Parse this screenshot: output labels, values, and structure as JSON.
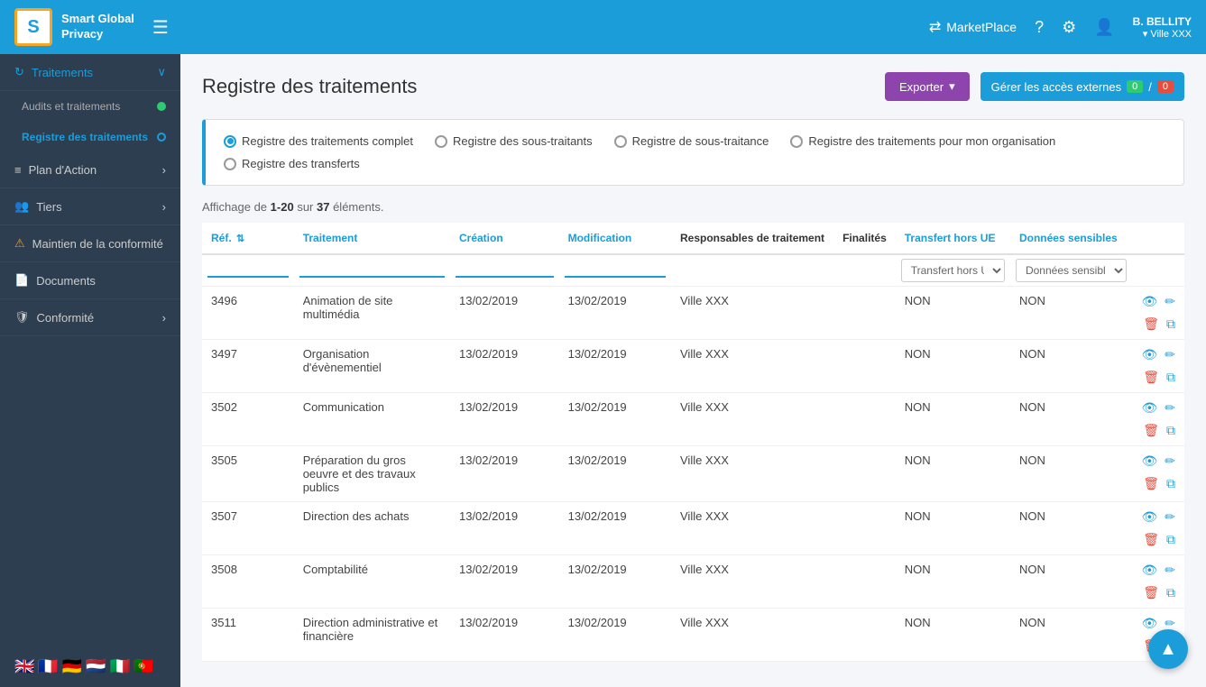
{
  "topnav": {
    "logo_letter": "S",
    "logo_text_line1": "Smart Global",
    "logo_text_line2": "Privacy",
    "menu_icon": "☰",
    "marketplace_label": "MarketPlace",
    "user_name": "B. BELLITY",
    "user_org": "▾ Ville XXX"
  },
  "sidebar": {
    "items": [
      {
        "label": "Traitements",
        "icon": "↻",
        "arrow": "∨",
        "active": true,
        "has_dot": "blue"
      },
      {
        "label": "Audits et traitements",
        "sub": true,
        "has_dot": "green"
      },
      {
        "label": "Registre des traitements",
        "sub": true,
        "has_dot": "outline",
        "active": true
      },
      {
        "label": "Plan d'Action",
        "icon": "≡",
        "arrow": "›"
      },
      {
        "label": "Tiers",
        "icon": "👥",
        "arrow": "›"
      },
      {
        "label": "Maintien de la conformité",
        "icon": "⚠",
        "warn": true
      },
      {
        "label": "Documents",
        "icon": "📄"
      },
      {
        "label": "Conformité",
        "icon": "🛡",
        "arrow": "›"
      }
    ],
    "flags": [
      "🇬🇧",
      "🇫🇷",
      "🇩🇪",
      "🇳🇱",
      "🇮🇹",
      "🇵🇹"
    ]
  },
  "page": {
    "title": "Registre des traitements",
    "export_btn": "Exporter",
    "acces_btn": "Gérer les accès externes",
    "acces_count1": "0",
    "acces_sep": "/",
    "acces_count2": "0"
  },
  "filters": {
    "options": [
      {
        "label": "Registre des traitements complet",
        "selected": true
      },
      {
        "label": "Registre des sous-traitants",
        "selected": false
      },
      {
        "label": "Registre de sous-traitance",
        "selected": false
      },
      {
        "label": "Registre des traitements pour mon organisation",
        "selected": false
      },
      {
        "label": "Registre des transferts",
        "selected": false
      }
    ]
  },
  "table": {
    "count_text": "Affichage de ",
    "count_range": "1-20",
    "count_mid": " sur ",
    "count_total": "37",
    "count_end": " éléments.",
    "columns": [
      {
        "label": "Réf.",
        "color": "blue",
        "sort": true
      },
      {
        "label": "Traitement",
        "color": "blue"
      },
      {
        "label": "Création",
        "color": "blue"
      },
      {
        "label": "Modification",
        "color": "blue"
      },
      {
        "label": "Responsables de traitement",
        "color": "dark"
      },
      {
        "label": "Finalités",
        "color": "dark"
      },
      {
        "label": "Transfert hors UE",
        "color": "blue"
      },
      {
        "label": "Données sensibles",
        "color": "blue"
      },
      {
        "label": "",
        "color": "dark"
      }
    ],
    "filter_placeholders": {
      "transfert": "Transfert hors UE",
      "donnees": "Données sensibles"
    },
    "rows": [
      {
        "ref": "3496",
        "traitement": "Animation de site multimédia",
        "creation": "13/02/2019",
        "modification": "13/02/2019",
        "responsables": "Ville XXX",
        "finalites": "",
        "transfert": "NON",
        "donnees": "NON"
      },
      {
        "ref": "3497",
        "traitement": "Organisation d'évènementiel",
        "creation": "13/02/2019",
        "modification": "13/02/2019",
        "responsables": "Ville XXX",
        "finalites": "",
        "transfert": "NON",
        "donnees": "NON"
      },
      {
        "ref": "3502",
        "traitement": "Communication",
        "creation": "13/02/2019",
        "modification": "13/02/2019",
        "responsables": "Ville XXX",
        "finalites": "",
        "transfert": "NON",
        "donnees": "NON"
      },
      {
        "ref": "3505",
        "traitement": "Préparation du gros oeuvre et des travaux publics",
        "creation": "13/02/2019",
        "modification": "13/02/2019",
        "responsables": "Ville XXX",
        "finalites": "",
        "transfert": "NON",
        "donnees": "NON"
      },
      {
        "ref": "3507",
        "traitement": "Direction des achats",
        "creation": "13/02/2019",
        "modification": "13/02/2019",
        "responsables": "Ville XXX",
        "finalites": "",
        "transfert": "NON",
        "donnees": "NON"
      },
      {
        "ref": "3508",
        "traitement": "Comptabilité",
        "creation": "13/02/2019",
        "modification": "13/02/2019",
        "responsables": "Ville XXX",
        "finalites": "",
        "transfert": "NON",
        "donnees": "NON"
      },
      {
        "ref": "3511",
        "traitement": "Direction administrative et financière",
        "creation": "13/02/2019",
        "modification": "13/02/2019",
        "responsables": "Ville XXX",
        "finalites": "",
        "transfert": "NON",
        "donnees": "NON"
      }
    ]
  }
}
